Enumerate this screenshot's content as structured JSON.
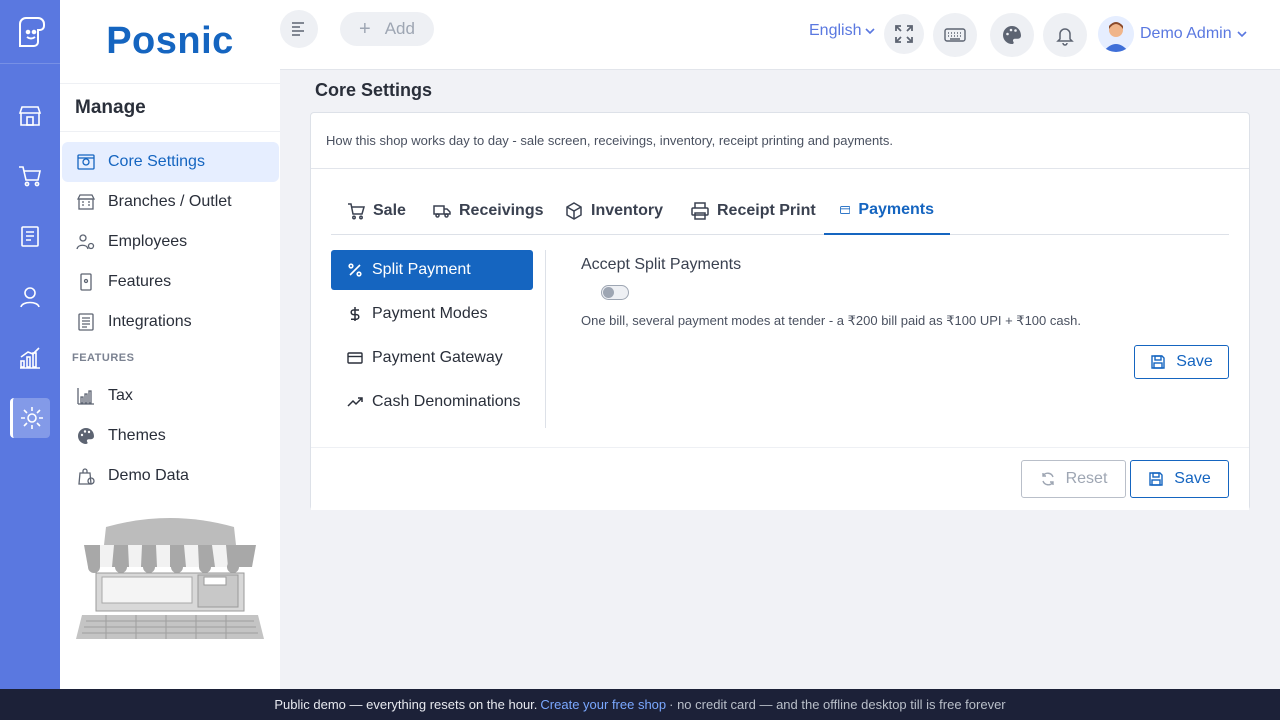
{
  "brand": {
    "name": "Posnic"
  },
  "rail": {
    "items": [
      "store-icon",
      "cart-icon",
      "clipboard-icon",
      "user-icon",
      "chart-icon",
      "gear-icon"
    ],
    "active": "gear-icon"
  },
  "sidebar": {
    "heading": "Manage",
    "items": [
      {
        "label": "Core Settings",
        "icon": "settings-panel-icon"
      },
      {
        "label": "Branches / Outlet",
        "icon": "building-icon"
      },
      {
        "label": "Employees",
        "icon": "employee-gear-icon"
      },
      {
        "label": "Features",
        "icon": "mobile-icon"
      },
      {
        "label": "Integrations",
        "icon": "list-icon"
      }
    ],
    "section_label": "FEATURES",
    "feature_items": [
      {
        "label": "Tax",
        "icon": "tax-chart-icon"
      },
      {
        "label": "Themes",
        "icon": "palette-icon"
      },
      {
        "label": "Demo Data",
        "icon": "bag-gear-icon"
      }
    ]
  },
  "topbar": {
    "add_label": "Add",
    "language": "English",
    "user_name": "Demo Admin",
    "icons": [
      "menu-toggle-icon",
      "fullscreen-icon",
      "keyboard-icon",
      "palette-icon",
      "bell-icon"
    ]
  },
  "page": {
    "title": "Core Settings",
    "description": "How this shop works day to day - sale screen, receivings, inventory, receipt printing and payments."
  },
  "tabs": [
    {
      "label": "Sale",
      "icon": "cart-icon"
    },
    {
      "label": "Receivings",
      "icon": "truck-icon"
    },
    {
      "label": "Inventory",
      "icon": "box-icon"
    },
    {
      "label": "Receipt Print",
      "icon": "printer-icon"
    },
    {
      "label": "Payments",
      "icon": "credit-card-icon",
      "active": true
    }
  ],
  "subnav": [
    {
      "label": "Split Payment",
      "icon": "percent-icon",
      "active": true
    },
    {
      "label": "Payment Modes",
      "icon": "dollar-icon"
    },
    {
      "label": "Payment Gateway",
      "icon": "credit-card-icon"
    },
    {
      "label": "Cash Denominations",
      "icon": "trending-up-icon"
    }
  ],
  "setting": {
    "label": "Accept Split Payments",
    "enabled": false,
    "help": "One bill, several payment modes at tender - a ₹200 bill paid as ₹100 UPI + ₹100 cash.",
    "save_label": "Save"
  },
  "footer": {
    "reset_label": "Reset",
    "save_label": "Save"
  },
  "banner": {
    "text": "Public demo — everything resets on the hour.",
    "link": "Create your free shop",
    "rest": "· no credit card — and the offline desktop till is free forever"
  },
  "colors": {
    "accent": "#1565c0",
    "rail": "#5a78e0",
    "banner": "#1c2138"
  }
}
